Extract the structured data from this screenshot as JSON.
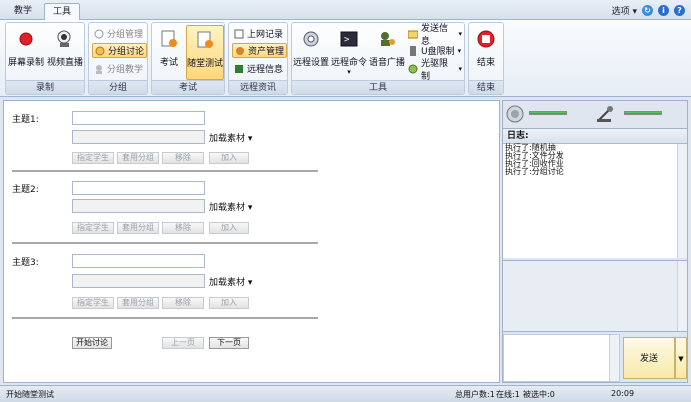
{
  "tabs": [
    {
      "label": "教学"
    },
    {
      "label": "工具"
    }
  ],
  "topright": {
    "options_label": "选项"
  },
  "ribbon": {
    "groups": {
      "record": {
        "label": "录制",
        "buttons": [
          "屏幕录制",
          "视频直播"
        ]
      },
      "group": {
        "label": "分组",
        "buttons": [
          "分组管理",
          "分组讨论",
          "分组教学"
        ]
      },
      "exam": {
        "label": "考试",
        "buttons": [
          "考试",
          "随堂测试"
        ]
      },
      "remote_info": {
        "label": "远程资讯",
        "buttons": [
          "上网记录",
          "资产管理",
          "远程信息"
        ]
      },
      "tools": {
        "label": "工具",
        "buttons": [
          "远程设置",
          "远程命令",
          "语音广播",
          "发送信息",
          "U盘限制",
          "光驱限制"
        ]
      },
      "end": {
        "label": "结束",
        "buttons": [
          "结束"
        ]
      }
    }
  },
  "main": {
    "topics": [
      {
        "label": "主题1:"
      },
      {
        "label": "主题2:"
      },
      {
        "label": "主题3:"
      }
    ],
    "load_material": "加载素材",
    "row_buttons": [
      "指定学生",
      "套用分组",
      "移除",
      "加入"
    ],
    "start_discussion": "开始讨论",
    "prev_page": "上一页",
    "next_page": "下一页"
  },
  "right": {
    "log_title": "日志:",
    "log_lines": [
      "执行了:随机抽",
      "执行了:文件分发",
      "执行了:回收作业",
      "执行了:分组讨论"
    ],
    "send_label": "发送"
  },
  "status": {
    "left_text": "开始随堂测试",
    "users_total": "总用户数:1",
    "online": "在线:1",
    "selected": "被选中:0",
    "time": "20:09"
  }
}
